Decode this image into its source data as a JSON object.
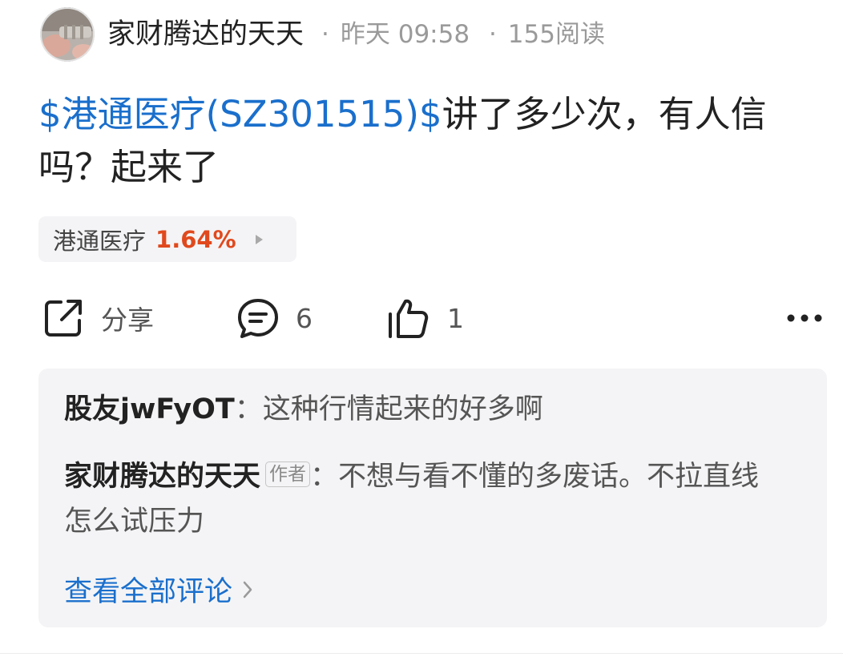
{
  "post": {
    "author": "家财腾达的天天",
    "time": "昨天 09:58",
    "reads": "155阅读",
    "separator": "·",
    "stock_link": "$港通医疗(SZ301515)$",
    "text_rest": "讲了多少次，有人信吗？起来了"
  },
  "stock_chip": {
    "name": "港通医疗",
    "change": "1.64%"
  },
  "actions": {
    "share_label": "分享",
    "comment_count": "6",
    "like_count": "1"
  },
  "comments": [
    {
      "user": "股友jwFyOT",
      "colon": "：",
      "text": "这种行情起来的好多啊"
    },
    {
      "user": "家财腾达的天天",
      "tag": "作者",
      "colon": "：",
      "text": "不想与看不懂的多废话。不拉直线怎么试压力"
    }
  ],
  "view_all_label": "查看全部评论",
  "colors": {
    "link_blue": "#1a6fcc",
    "up_red": "#e0491d",
    "panel_gray": "#f4f4f6"
  },
  "icons": [
    "share-icon",
    "comment-icon",
    "thumbs-up-icon",
    "more-icon",
    "chevron-right-icon",
    "triangle-right-icon"
  ]
}
